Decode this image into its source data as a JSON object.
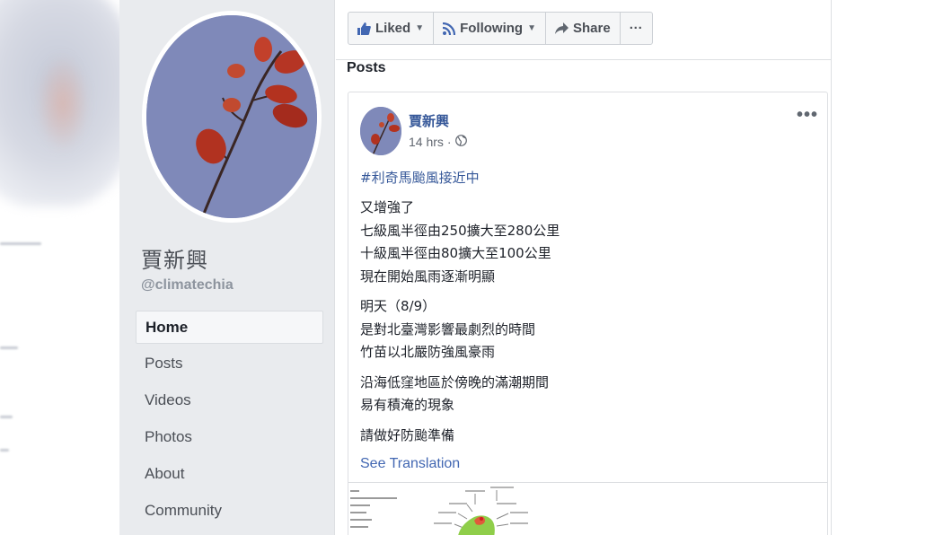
{
  "page": {
    "name": "賈新興",
    "handle": "@climatechia"
  },
  "nav": {
    "items": [
      {
        "label": "Home"
      },
      {
        "label": "Posts"
      },
      {
        "label": "Videos"
      },
      {
        "label": "Photos"
      },
      {
        "label": "About"
      },
      {
        "label": "Community"
      }
    ]
  },
  "actions": {
    "liked": "Liked",
    "following": "Following",
    "share": "Share",
    "more": "···"
  },
  "posts_heading": "Posts",
  "post": {
    "author": "賈新興",
    "time": "14 hrs",
    "privacy_icon": "globe-icon",
    "more": "•••",
    "hashtag": "#利奇馬颱風接近中",
    "paragraphs": [
      [
        "又增強了",
        "七級風半徑由250擴大至280公里",
        "十級風半徑由80擴大至100公里",
        "現在開始風雨逐漸明顯"
      ],
      [
        "明天（8/9）",
        "是對北臺灣影響最劇烈的時間",
        "竹苗以北嚴防強風豪雨"
      ],
      [
        "沿海低窪地區於傍晚的滿潮期間",
        "易有積淹的現象"
      ],
      [
        "請做好防颱準備"
      ]
    ],
    "see_translation": "See Translation"
  },
  "colors": {
    "link": "#365899",
    "sidebar_bg": "#e9ebee",
    "accent": "#4267b2"
  }
}
